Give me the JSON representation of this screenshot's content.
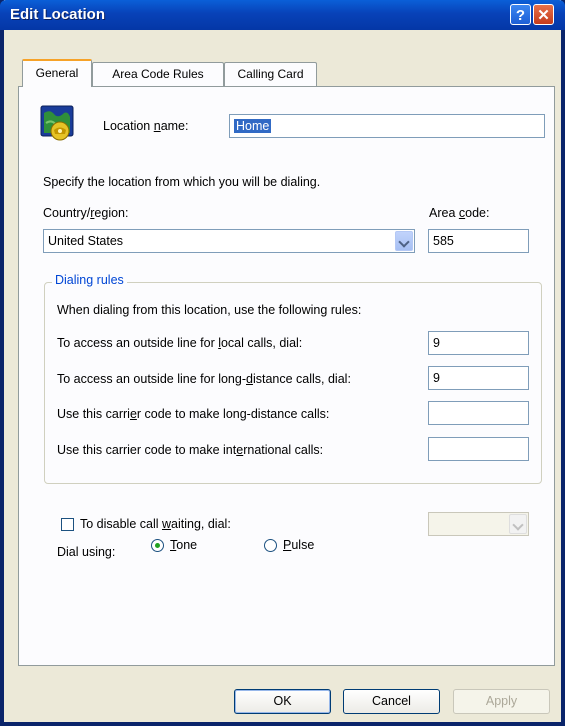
{
  "window": {
    "title": "Edit Location",
    "help_icon": "question-mark",
    "close_icon": "x-close"
  },
  "tabs": [
    {
      "label": "General",
      "active": true
    },
    {
      "label": "Area Code Rules",
      "active": false
    },
    {
      "label": "Calling Card",
      "active": false
    }
  ],
  "general": {
    "location_icon": "globe-phone-icon",
    "location_name_label_pre": "Location ",
    "location_name_label_u": "n",
    "location_name_label_post": "ame:",
    "location_name_value": "Home",
    "instruction": "Specify the location from which you will be dialing.",
    "country_label_pre": "Country/",
    "country_label_u": "r",
    "country_label_post": "egion:",
    "country_value": "United States",
    "area_code_label_pre": "Area ",
    "area_code_label_u": "c",
    "area_code_label_post": "ode:",
    "area_code_value": "585"
  },
  "dialing_rules": {
    "title": "Dialing rules",
    "intro": "When dialing from this location, use the following rules:",
    "local_pre": "To access an outside line for ",
    "local_u": "l",
    "local_post": "ocal calls, dial:",
    "local_value": "9",
    "long_pre": "To access an outside line for long-",
    "long_u": "d",
    "long_post": "istance calls, dial:",
    "long_value": "9",
    "carrier_long_pre": "Use this carri",
    "carrier_long_u": "e",
    "carrier_long_post": "r code to make long-distance calls:",
    "carrier_long_value": "",
    "carrier_intl_pre": "Use this carrier code to make int",
    "carrier_intl_u": "e",
    "carrier_intl_post": "rnational calls:",
    "carrier_intl_value": ""
  },
  "call_waiting": {
    "label_pre": "To disable call ",
    "label_u": "w",
    "label_post": "aiting, dial:",
    "checked": false,
    "value": ""
  },
  "dial_using": {
    "label": "Dial using:",
    "tone_u": "T",
    "tone_post": "one",
    "pulse_u": "P",
    "pulse_post": "ulse",
    "selected": "Tone"
  },
  "buttons": {
    "ok": "OK",
    "cancel": "Cancel",
    "apply": "Apply"
  }
}
